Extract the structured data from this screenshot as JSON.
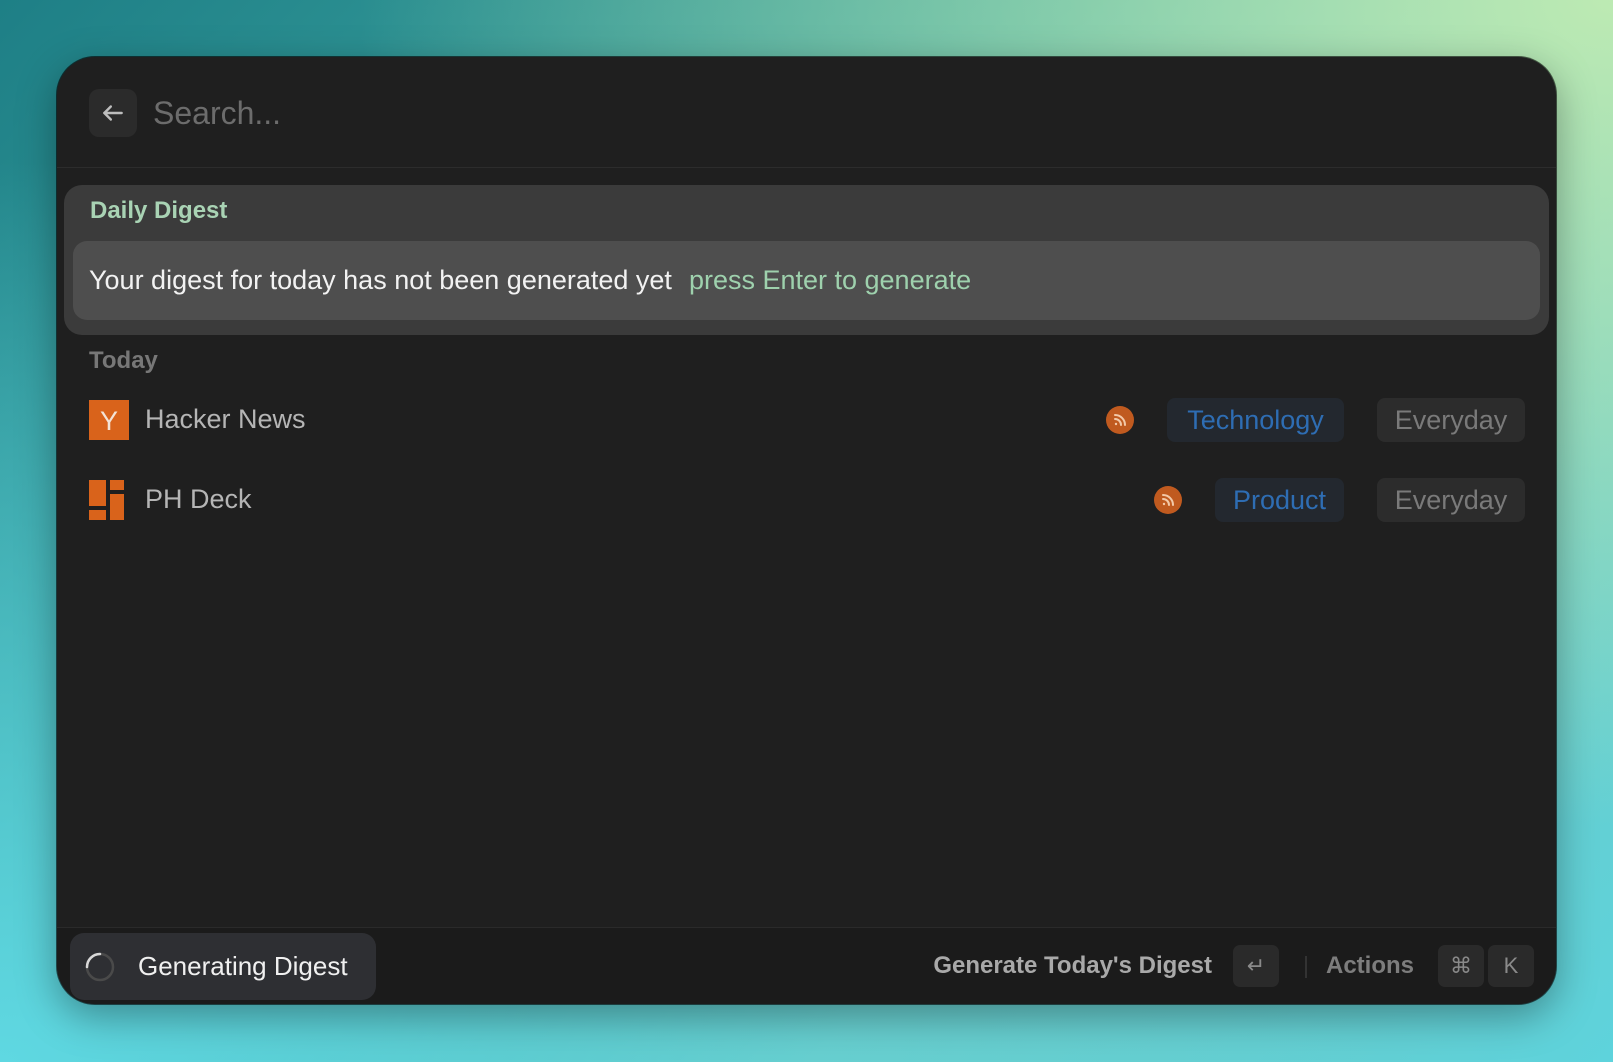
{
  "search": {
    "placeholder": "Search..."
  },
  "digest": {
    "section_title": "Daily Digest",
    "message": "Your digest for today has not been generated yet",
    "hint": "press Enter to generate"
  },
  "today": {
    "section_title": "Today",
    "feeds": [
      {
        "name": "Hacker News",
        "icon": "hacker-news-logo",
        "category": "Technology",
        "frequency": "Everyday"
      },
      {
        "name": "PH Deck",
        "icon": "ph-deck-logo",
        "category": "Product",
        "frequency": "Everyday"
      }
    ]
  },
  "footer": {
    "toast_label": "Generating Digest",
    "primary_action": "Generate Today's Digest",
    "primary_key": "↵",
    "actions_label": "Actions",
    "actions_keys": [
      "⌘",
      "K"
    ]
  },
  "colors": {
    "accent_green": "#a9d3b4",
    "hint_green": "#9ed1ad",
    "tag_blue": "#2e6db3",
    "rss_orange": "#c05a1f",
    "window_bg": "#1f1f1f"
  }
}
